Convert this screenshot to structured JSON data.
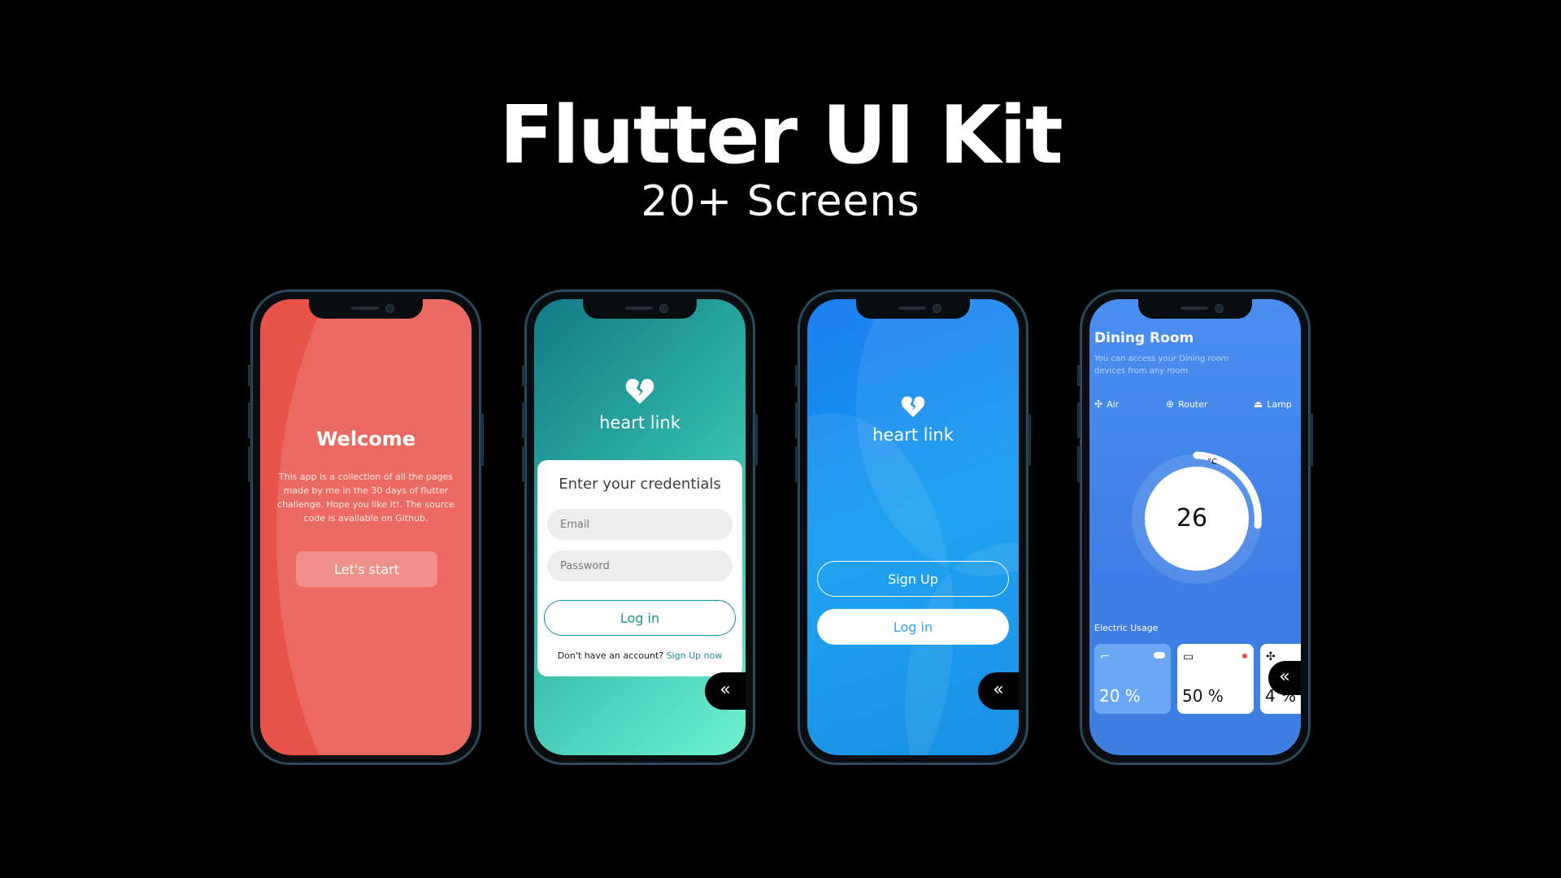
{
  "header": {
    "title": "Flutter UI Kit",
    "subtitle": "20+ Screens"
  },
  "screen1": {
    "title": "Welcome",
    "description": "This app is a collection of all the pages made by me in the 30 days of flutter challenge. Hope you like it!. The source code is available on Github.",
    "button": "Let's start",
    "color": "#e8534a"
  },
  "screen2": {
    "brand": "heart link",
    "card_title": "Enter your credentials",
    "email_placeholder": "Email",
    "password_placeholder": "Password",
    "login": "Log in",
    "no_account": "Don't have an account?",
    "signup_link": "Sign Up now",
    "collapse_icon": "«",
    "accent": "#19909a"
  },
  "screen3": {
    "brand": "heart link",
    "signup": "Sign Up",
    "login": "Log in",
    "collapse_icon": "«",
    "accent": "#0e9bf0"
  },
  "screen4": {
    "room": "Dining Room",
    "description": "You can access your Dining room devices from any room",
    "devices": [
      {
        "icon": "ac-icon",
        "label": "Air"
      },
      {
        "icon": "router-icon",
        "label": "Router"
      },
      {
        "icon": "lamp-icon",
        "label": "Lamp"
      }
    ],
    "temperature": "26",
    "unit": "°C",
    "electric_label": "Electric Usage",
    "usage": [
      {
        "icon": "lamp-icon",
        "value": "20 %"
      },
      {
        "icon": "router-icon",
        "value": "50 %"
      },
      {
        "icon": "ac-icon",
        "value": "4 %"
      }
    ],
    "collapse_icon": "«"
  }
}
